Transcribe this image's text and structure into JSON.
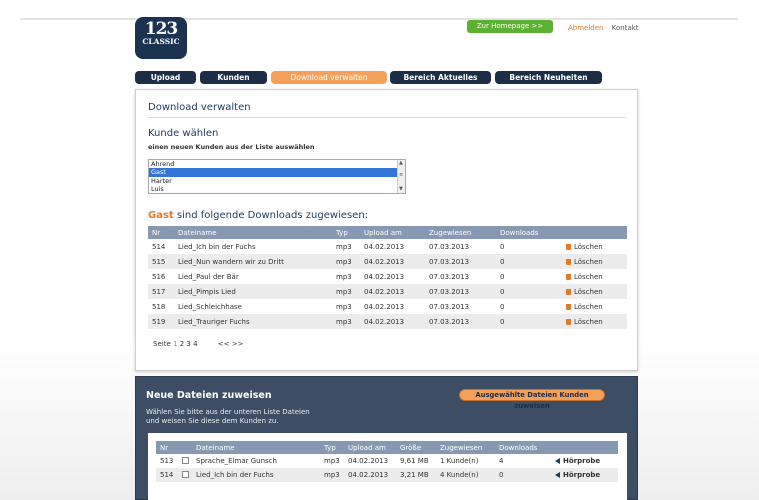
{
  "logo": {
    "numbers": "123",
    "word": "CLASSIC"
  },
  "header": {
    "homepage_button": "Zur Homepage >>",
    "logout": "Abmelden",
    "contact": "Kontakt"
  },
  "tabs": [
    "Upload",
    "Kunden",
    "Download verwalten",
    "Bereich Aktuelles",
    "Bereich Neuheiten"
  ],
  "main": {
    "title": "Download verwalten",
    "customer_heading": "Kunde wählen",
    "customer_sub": "einen neuen Kunden aus der Liste auswählen",
    "customers": [
      "Ahrend",
      "Gast",
      "Harter",
      "Luis"
    ],
    "selected_customer": "Gast",
    "downloads_heading_name": "Gast",
    "downloads_heading_rest": " sind folgende Downloads zugewiesen:",
    "table_headers": [
      "Nr",
      "Dateiname",
      "Typ",
      "Upload am",
      "Zugewiesen",
      "Downloads",
      ""
    ],
    "rows": [
      {
        "nr": "514",
        "name": "Lied_Ich bin der Fuchs",
        "typ": "mp3",
        "upload": "04.02.2013",
        "zug": "07.03.2013",
        "dl": "0",
        "action": "Löschen"
      },
      {
        "nr": "515",
        "name": "Lied_Nun wandern wir zu Dritt",
        "typ": "mp3",
        "upload": "04.02.2013",
        "zug": "07.03.2013",
        "dl": "0",
        "action": "Löschen"
      },
      {
        "nr": "516",
        "name": "Lied_Paul der Bär",
        "typ": "mp3",
        "upload": "04.02.2013",
        "zug": "07.03.2013",
        "dl": "0",
        "action": "Löschen"
      },
      {
        "nr": "517",
        "name": "Lied_Pimpis Lied",
        "typ": "mp3",
        "upload": "04.02.2013",
        "zug": "07.03.2013",
        "dl": "0",
        "action": "Löschen"
      },
      {
        "nr": "518",
        "name": "Lied_Schleichhase",
        "typ": "mp3",
        "upload": "04.02.2013",
        "zug": "07.03.2013",
        "dl": "0",
        "action": "Löschen"
      },
      {
        "nr": "519",
        "name": "Lied_Trauriger Fuchs",
        "typ": "mp3",
        "upload": "04.02.2013",
        "zug": "07.03.2013",
        "dl": "0",
        "action": "Löschen"
      }
    ],
    "pager": {
      "label": "Seite",
      "current": "1",
      "pages": [
        "2",
        "3",
        "4"
      ],
      "prev": "<<",
      "next": ">>"
    }
  },
  "assign_section": {
    "title": "Neue Dateien zuweisen",
    "sub_line1": "Wählen Sie bitte aus der unteren Liste Dateien",
    "sub_line2": "und weisen Sie diese dem Kunden zu.",
    "assign_button": "Ausgewählte Dateien Kunden zuweisen",
    "headers": [
      "Nr",
      "",
      "Dateiname",
      "Typ",
      "Upload am",
      "Größe",
      "Zugewiesen",
      "Downloads",
      ""
    ],
    "rows": [
      {
        "nr": "513",
        "name": "Sprache_Elmar Gunsch",
        "typ": "mp3",
        "upload": "04.02.2013",
        "size": "9,61 MB",
        "zug": "1 Kunde(n)",
        "dl": "4",
        "action": "Hörprobe"
      },
      {
        "nr": "514",
        "name": "Lied_Ich bin der Fuchs",
        "typ": "mp3",
        "upload": "04.02.2013",
        "size": "3,21 MB",
        "zug": "4 Kunde(n)",
        "dl": "0",
        "action": "Hörprobe"
      }
    ]
  }
}
